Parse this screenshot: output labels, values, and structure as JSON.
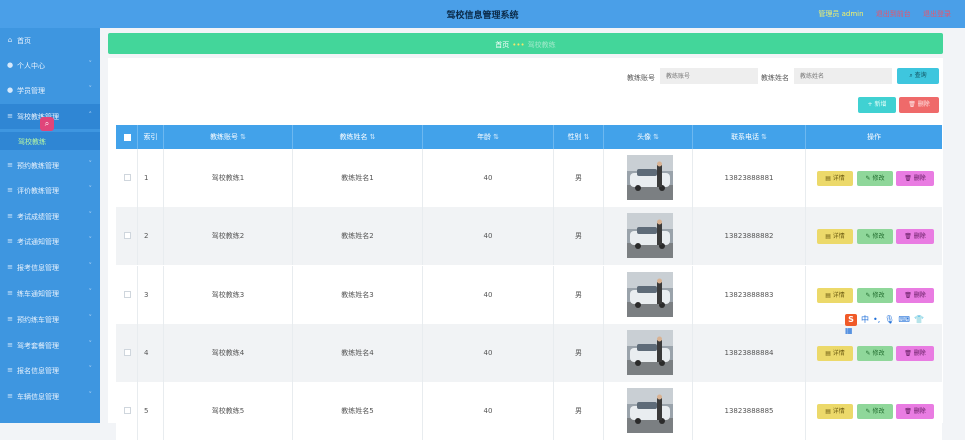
{
  "header": {
    "title": "驾校信息管理系统",
    "admin": "管理员 admin",
    "back_front": "退出到前台",
    "logout": "退出登录"
  },
  "sidebar": {
    "items": [
      {
        "label": "首页",
        "icon": "home-icon"
      },
      {
        "label": "个人中心",
        "icon": "user-icon"
      },
      {
        "label": "学员管理",
        "icon": "user-icon"
      },
      {
        "label": "驾校教练管理",
        "icon": "list-icon"
      },
      {
        "label": "预约教练管理",
        "icon": "list-icon"
      },
      {
        "label": "评价教练管理",
        "icon": "list-icon"
      },
      {
        "label": "考试成绩管理",
        "icon": "list-icon"
      },
      {
        "label": "考试通知管理",
        "icon": "list-icon"
      },
      {
        "label": "报考信息管理",
        "icon": "list-icon"
      },
      {
        "label": "练车通知管理",
        "icon": "list-icon"
      },
      {
        "label": "预约练车管理",
        "icon": "list-icon"
      },
      {
        "label": "驾考套餐管理",
        "icon": "list-icon"
      },
      {
        "label": "报名信息管理",
        "icon": "list-icon"
      },
      {
        "label": "车辆信息管理",
        "icon": "list-icon"
      }
    ],
    "sub_active": "驾校教练"
  },
  "breadcrumb": {
    "home": "首页",
    "current": "驾校教练"
  },
  "search": {
    "label1": "教练账号",
    "placeholder1": "教练账号",
    "label2": "教练姓名",
    "placeholder2": "教练姓名",
    "query": "查询"
  },
  "toolbar": {
    "add": "新增",
    "remove": "删除"
  },
  "table": {
    "headers": [
      "索引",
      "教练账号",
      "教练姓名",
      "年龄",
      "性别",
      "头像",
      "联系电话",
      "操作"
    ],
    "rows": [
      {
        "index": "1",
        "account": "驾校教练1",
        "name": "教练姓名1",
        "age": "40",
        "gender": "男",
        "phone": "13823888881"
      },
      {
        "index": "2",
        "account": "驾校教练2",
        "name": "教练姓名2",
        "age": "40",
        "gender": "男",
        "phone": "13823888882"
      },
      {
        "index": "3",
        "account": "驾校教练3",
        "name": "教练姓名3",
        "age": "40",
        "gender": "男",
        "phone": "13823888883"
      },
      {
        "index": "4",
        "account": "驾校教练4",
        "name": "教练姓名4",
        "age": "40",
        "gender": "男",
        "phone": "13823888884"
      },
      {
        "index": "5",
        "account": "驾校教练5",
        "name": "教练姓名5",
        "age": "40",
        "gender": "男",
        "phone": "13823888885"
      }
    ],
    "actions": {
      "detail": "详情",
      "edit": "修改",
      "remove": "删除"
    }
  },
  "ime": {
    "letter": "S",
    "text": "中"
  }
}
